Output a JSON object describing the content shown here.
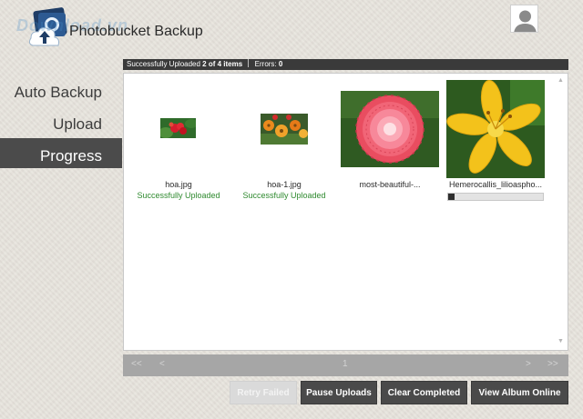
{
  "app": {
    "title": "Photobucket Backup",
    "watermark": "Download.vn"
  },
  "sidebar": {
    "items": [
      {
        "label": "Auto Backup",
        "active": false
      },
      {
        "label": "Upload",
        "active": false
      },
      {
        "label": "Progress",
        "active": true
      }
    ]
  },
  "status": {
    "prefix": "Successfully Uploaded",
    "count": "2 of 4 items",
    "errors_label": "Errors:",
    "errors_count": "0"
  },
  "uploads": [
    {
      "filename": "hoa.jpg",
      "status": "Successfully Uploaded"
    },
    {
      "filename": "hoa-1.jpg",
      "status": "Successfully Uploaded"
    },
    {
      "filename": "most-beautiful-...",
      "status": ""
    },
    {
      "filename": "Hemerocallis_lilioaspho...",
      "status": "",
      "progress": 0.07
    }
  ],
  "pager": {
    "first": "<<",
    "prev": "<",
    "page": "1",
    "next": ">",
    "last": ">>"
  },
  "buttons": {
    "retry": "Retry Failed",
    "pause": "Pause Uploads",
    "clear": "Clear Completed",
    "view": "View Album Online"
  },
  "colors": {
    "status_bar": "#3a3a3a",
    "success_text": "#2f8a2f",
    "active_nav": "#4b4b4b",
    "button_dark": "#4a4a4a"
  }
}
